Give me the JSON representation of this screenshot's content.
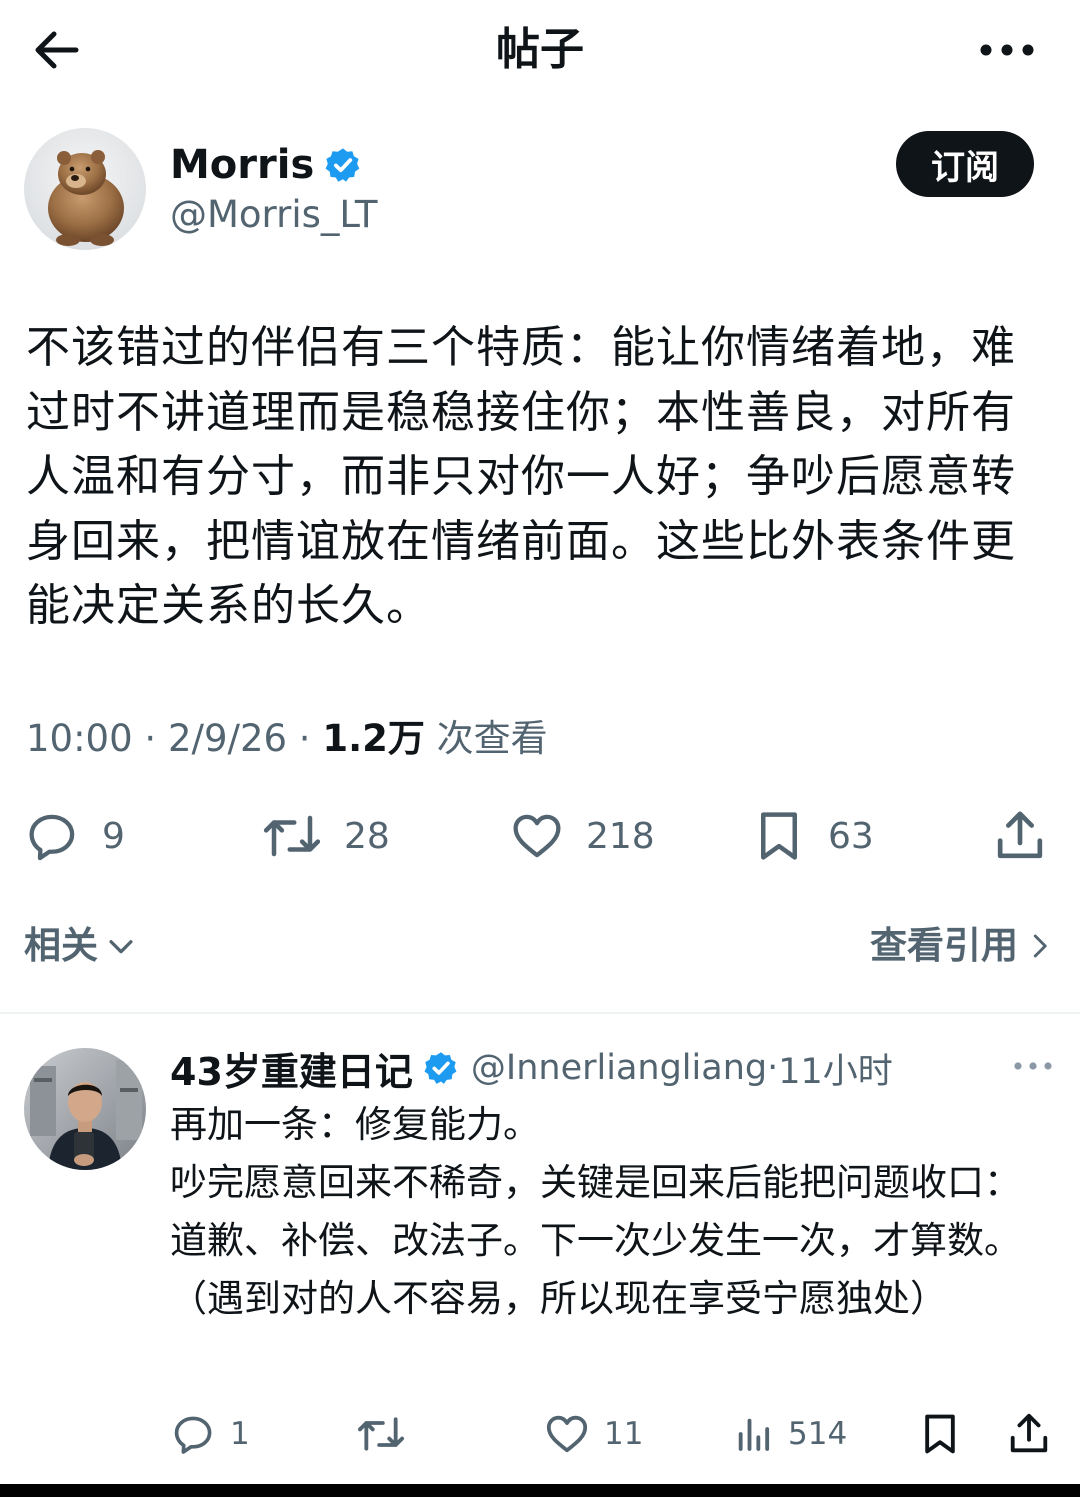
{
  "topbar": {
    "title": "帖子"
  },
  "post": {
    "author": {
      "name": "Morris",
      "handle": "@Morris_LT",
      "verified": true,
      "avatar": "bear-photo"
    },
    "subscribe_label": "订阅",
    "text": "不该错过的伴侣有三个特质：能让你情绪着地，难过时不讲道理而是稳稳接住你；本性善良，对所有人温和有分寸，而非只对你一人好；争吵后愿意转身回来，把情谊放在情绪前面。这些比外表条件更能决定关系的长久。",
    "meta": {
      "time": "10:00",
      "date": "2/9/26",
      "views": "1.2万",
      "views_label": "次查看"
    },
    "stats": {
      "replies": "9",
      "reposts": "28",
      "likes": "218",
      "bookmarks": "63"
    }
  },
  "related": {
    "label": "相关",
    "quotes_link": "查看引用"
  },
  "reply": {
    "author": {
      "name": "43岁重建日记",
      "handle": "@Innerliangliang",
      "verified": true,
      "avatar": "man-selfie-photo"
    },
    "time": "11小时",
    "text": "再加一条：修复能力。\n吵完愿意回来不稀奇，关键是回来后能把问题收口：道歉、补偿、改法子。下一次少发生一次，才算数。（遇到对的人不容易，所以现在享受宁愿独处）",
    "stats": {
      "replies": "1",
      "reposts": "",
      "likes": "11",
      "views": "514"
    }
  },
  "colors": {
    "text_primary": "#0f1419",
    "text_secondary": "#536471",
    "verified_blue": "#1d9bf0",
    "button_dark": "#0f1419"
  }
}
